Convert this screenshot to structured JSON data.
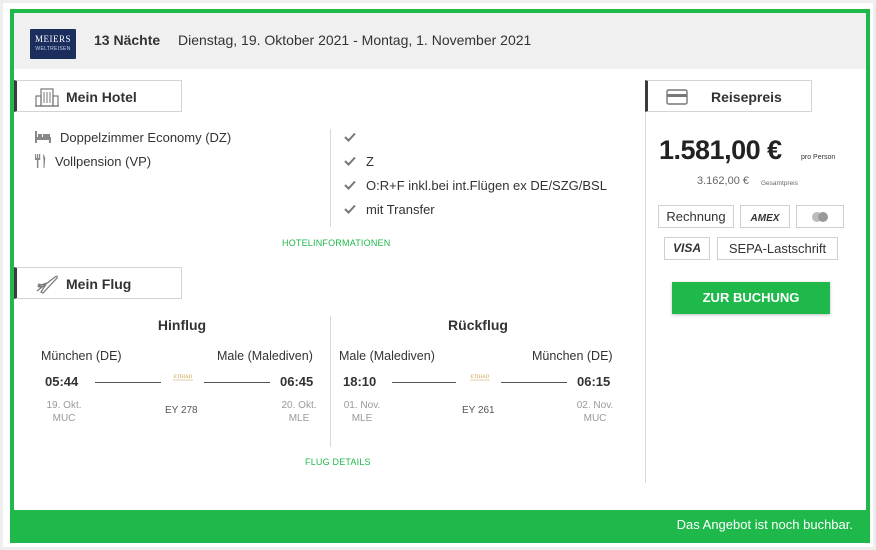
{
  "header": {
    "logo_line1": "MEIERS",
    "logo_line2": "WELTREISEN",
    "nights": "13 Nächte",
    "dates": "Dienstag, 19. Oktober 2021 - Montag, 1. November 2021"
  },
  "hotel": {
    "tab_label": "Mein Hotel",
    "room": "Doppelzimmer Economy (DZ)",
    "board": "Vollpension (VP)",
    "features": [
      "",
      "Z",
      "O:R+F inkl.bei int.Flügen ex DE/SZG/BSL",
      "mit Transfer"
    ],
    "info_link": "HOTELINFORMATIONEN"
  },
  "flight": {
    "tab_label": "Mein Flug",
    "outbound": {
      "title": "Hinflug",
      "from_city": "München (DE)",
      "to_city": "Male (Malediven)",
      "dep_time": "05:44",
      "arr_time": "06:45",
      "dep_date": "19. Okt.",
      "dep_code": "MUC",
      "arr_date": "20. Okt.",
      "arr_code": "MLE",
      "flight_no": "EY 278",
      "airline_logo_text": "ETIHAD"
    },
    "return": {
      "title": "Rückflug",
      "from_city": "Male (Malediven)",
      "to_city": "München (DE)",
      "dep_time": "18:10",
      "arr_time": "06:15",
      "dep_date": "01. Nov.",
      "dep_code": "MLE",
      "arr_date": "02. Nov.",
      "arr_code": "MUC",
      "flight_no": "EY 261",
      "airline_logo_text": "ETIHAD"
    },
    "details_link": "FLUG DETAILS"
  },
  "price": {
    "tab_label": "Reisepreis",
    "per_person": "1.581,00 €",
    "per_person_label": "pro Person",
    "total": "3.162,00 €",
    "total_label": "Gesamtpreis",
    "payment_methods": [
      "Rechnung",
      "AMEX",
      "Mastercard",
      "VISA",
      "SEPA-Lastschrift"
    ],
    "book_button": "ZUR BUCHUNG"
  },
  "footer": {
    "status": "Das Angebot ist noch buchbar."
  },
  "colors": {
    "accent": "#1eb84b",
    "logo_bg": "#1b2e5e",
    "header_bg": "#f0f0f0"
  }
}
